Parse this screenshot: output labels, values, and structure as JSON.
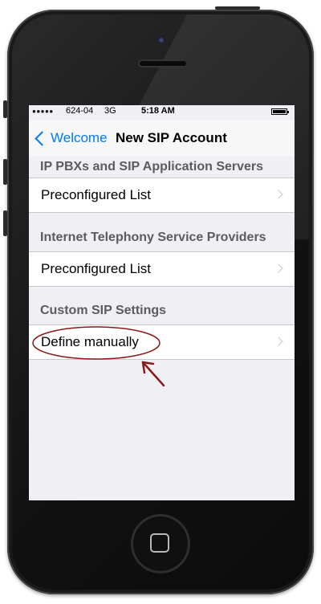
{
  "status_bar": {
    "signal": "●●●●●",
    "carrier": "624-04",
    "network": "3G",
    "time": "5:18 AM"
  },
  "nav": {
    "back_label": "Welcome",
    "title": "New SIP Account"
  },
  "sections": [
    {
      "header": "IP PBXs and SIP Application Servers",
      "row_label": "Preconfigured List"
    },
    {
      "header": "Internet Telephony Service Providers",
      "row_label": "Preconfigured List"
    },
    {
      "header": "Custom SIP Settings",
      "row_label": "Define manually"
    }
  ],
  "colors": {
    "accent": "#007aff",
    "annotation": "#8b1a1a",
    "background": "#efeff4"
  },
  "icons": [
    "back-chevron-icon",
    "disclosure-chevron-icon",
    "battery-icon",
    "home-button-icon"
  ]
}
